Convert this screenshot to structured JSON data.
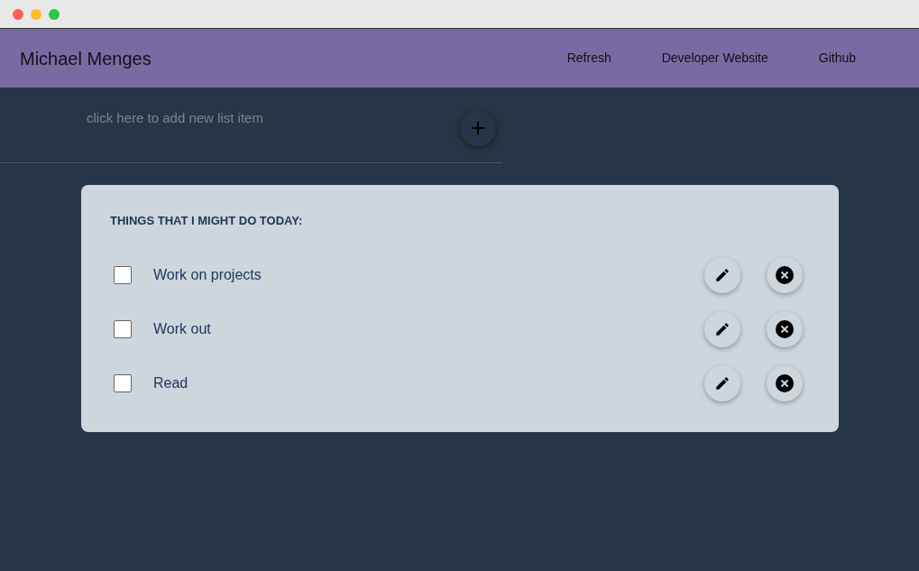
{
  "window": {
    "controls": [
      {
        "color": "#ff5f57"
      },
      {
        "color": "#febc2e"
      },
      {
        "color": "#28c840"
      }
    ]
  },
  "navbar": {
    "brand": "Michael Menges",
    "links": [
      "Refresh",
      "Developer Website",
      "Github"
    ]
  },
  "new_item": {
    "placeholder": "click here to add new list item"
  },
  "list": {
    "title": "THINGS THAT I MIGHT DO TODAY:",
    "items": [
      {
        "label": "Work on projects",
        "checked": false
      },
      {
        "label": "Work out",
        "checked": false
      },
      {
        "label": "Read",
        "checked": false
      }
    ]
  }
}
